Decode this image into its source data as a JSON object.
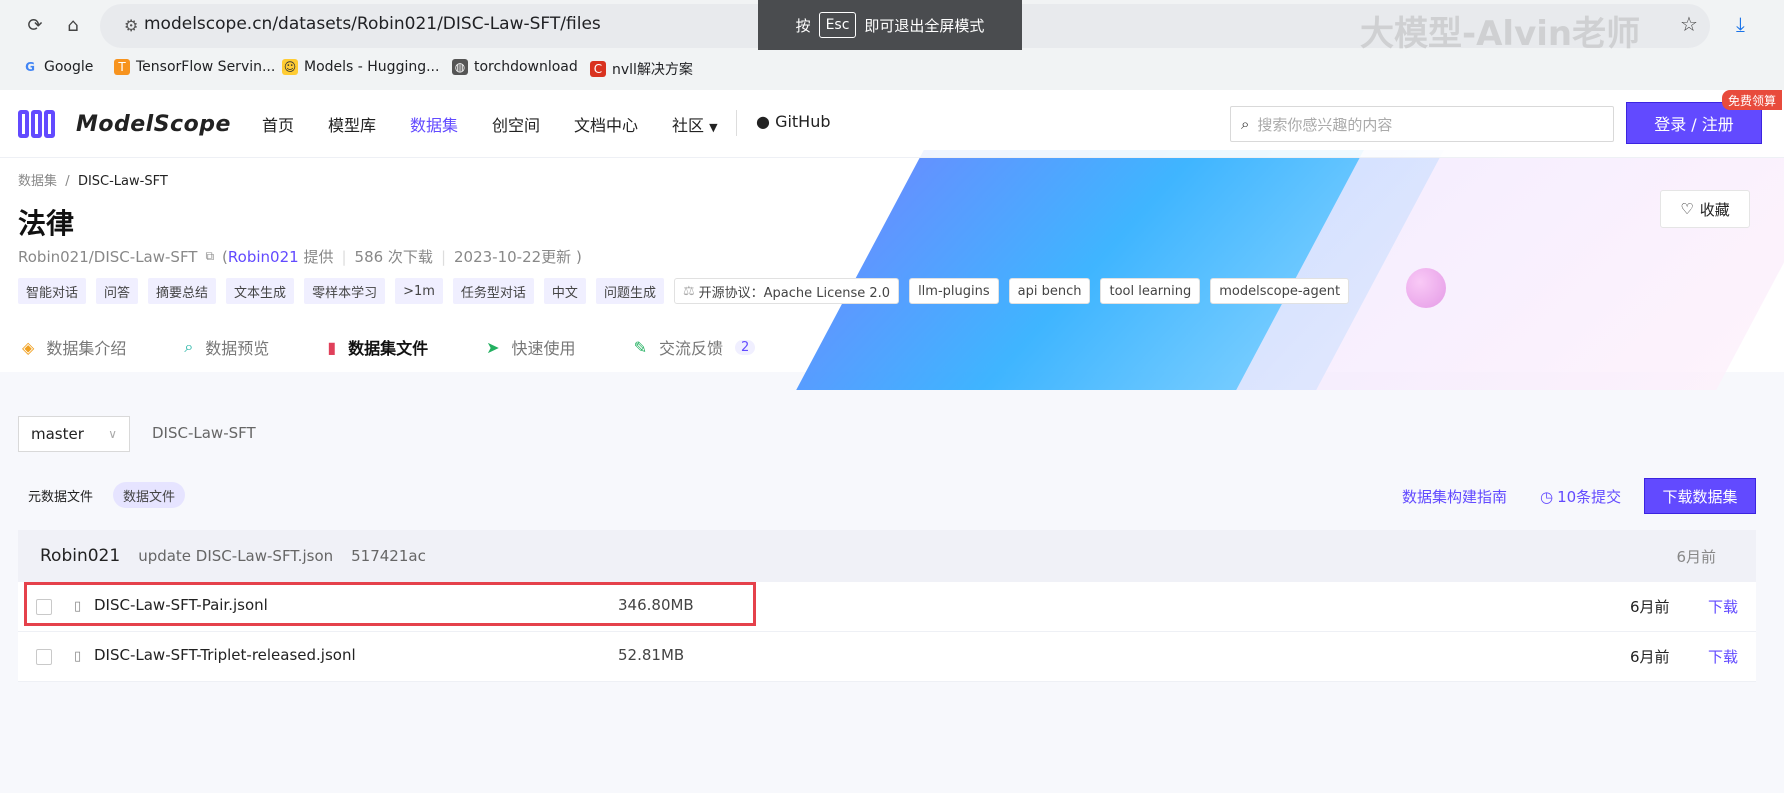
{
  "browser": {
    "url": "modelscope.cn/datasets/Robin021/DISC-Law-SFT/files",
    "esc_prefix": "按",
    "esc_key": "Esc",
    "esc_suffix": "即可退出全屏模式",
    "watermark": "大模型-Alvin老师",
    "bookmarks": [
      {
        "label": "Google",
        "icon": "G"
      },
      {
        "label": "TensorFlow Servin...",
        "icon": "T"
      },
      {
        "label": "Models - Hugging...",
        "icon": "H"
      },
      {
        "label": "torchdownload",
        "icon": "globe"
      },
      {
        "label": "nvll解决方案",
        "icon": "C"
      }
    ]
  },
  "nav": {
    "logo": "ModelScope",
    "items": [
      "首页",
      "模型库",
      "数据集",
      "创空间",
      "文档中心",
      "社区",
      "GitHub"
    ],
    "search_placeholder": "搜索你感兴趣的内容",
    "login": "登录 / 注册",
    "free_badge": "免费领算"
  },
  "dataset": {
    "crumb_root": "数据集",
    "crumb_sep": "/",
    "crumb_current": "DISC-Law-SFT",
    "title": "法律",
    "repo": "Robin021/DISC-Law-SFT",
    "provider_prefix": "(",
    "provider": "Robin021",
    "provider_suffix": "提供",
    "downloads": "586 次下载",
    "updated": "2023-10-22更新 )",
    "favorite": "收藏",
    "tags": [
      "智能对话",
      "问答",
      "摘要总结",
      "文本生成",
      "零样本学习",
      ">1m",
      "任务型对话",
      "中文",
      "问题生成"
    ],
    "license": "开源协议：Apache License 2.0",
    "tags_outline": [
      "llm-plugins",
      "api bench",
      "tool learning",
      "modelscope-agent"
    ],
    "tabs": [
      {
        "label": "数据集介绍"
      },
      {
        "label": "数据预览"
      },
      {
        "label": "数据集文件"
      },
      {
        "label": "快速使用"
      },
      {
        "label": "交流反馈",
        "count": "2"
      }
    ]
  },
  "files": {
    "branch": "master",
    "repo_name": "DISC-Law-SFT",
    "file_tabs": [
      "元数据文件",
      "数据文件"
    ],
    "guide": "数据集构建指南",
    "commits": "10条提交",
    "download_all": "下载数据集",
    "commit": {
      "author": "Robin021",
      "message": "update DISC-Law-SFT.json",
      "hash": "517421ac",
      "time": "6月前"
    },
    "rows": [
      {
        "name": "DISC-Law-SFT-Pair.jsonl",
        "size": "346.80MB",
        "time": "6月前",
        "action": "下载"
      },
      {
        "name": "DISC-Law-SFT-Triplet-released.jsonl",
        "size": "52.81MB",
        "time": "6月前",
        "action": "下载"
      }
    ]
  },
  "colors": {
    "accent": "#624aff",
    "highlight": "#e5414b"
  }
}
